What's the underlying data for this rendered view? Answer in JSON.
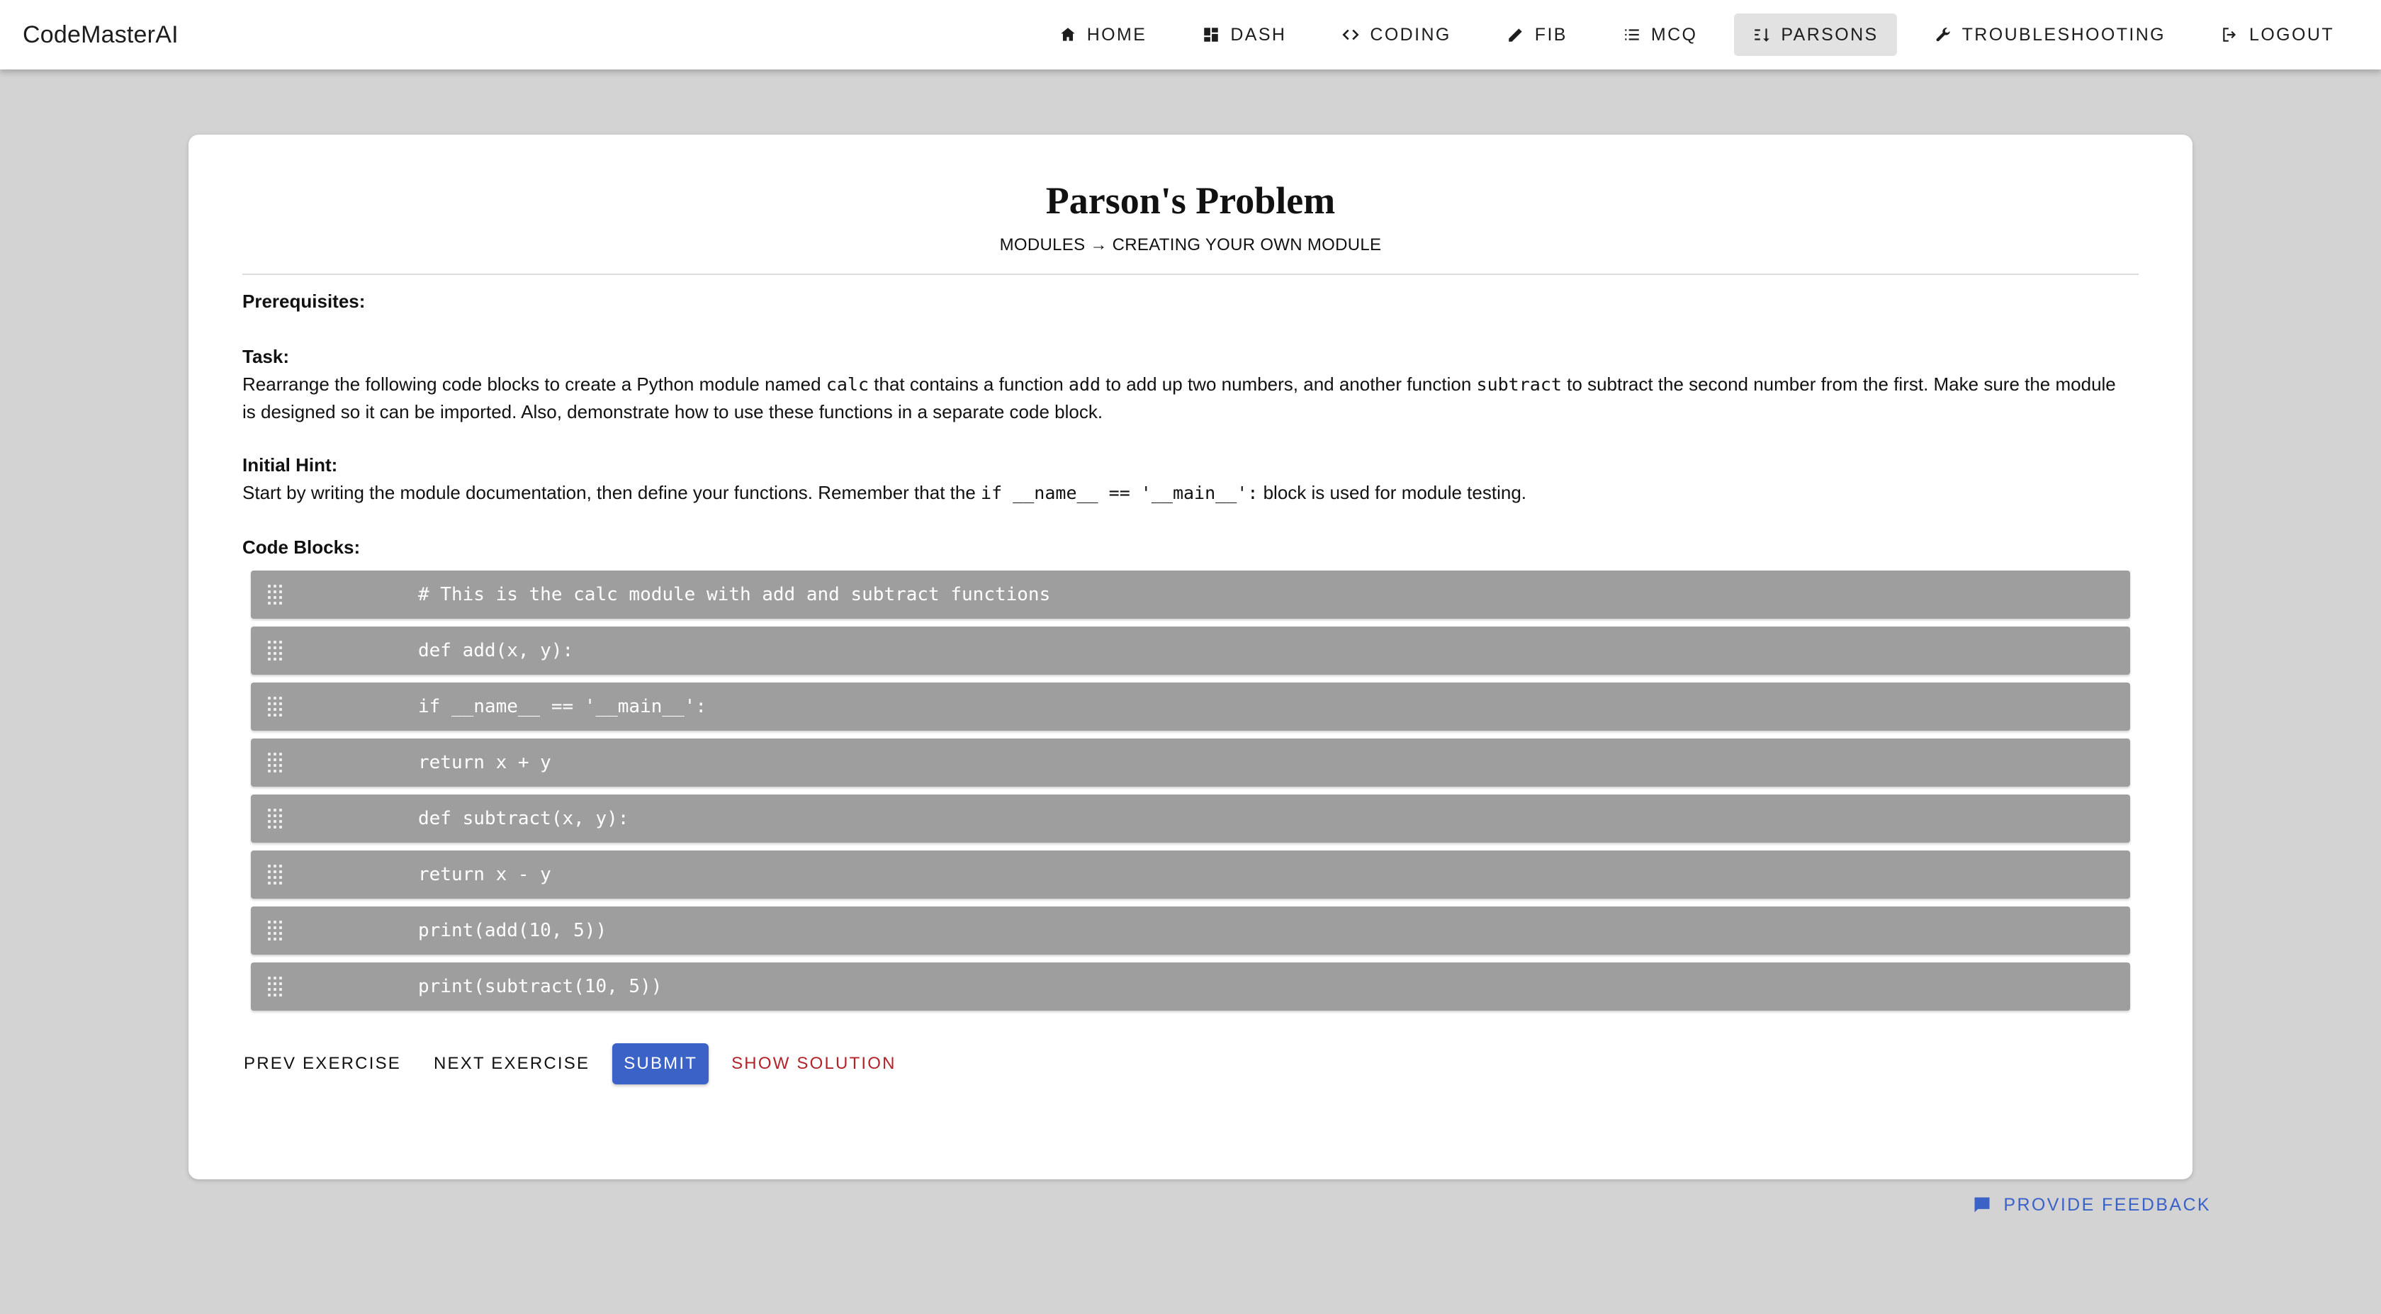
{
  "app": {
    "brand": "CodeMasterAI"
  },
  "nav": {
    "items": [
      {
        "label": "Home",
        "icon": "home-icon"
      },
      {
        "label": "Dash",
        "icon": "dashboard-icon"
      },
      {
        "label": "Coding",
        "icon": "code-icon"
      },
      {
        "label": "FIB",
        "icon": "pencil-icon"
      },
      {
        "label": "MCQ",
        "icon": "list-icon"
      },
      {
        "label": "Parsons",
        "icon": "sort-icon",
        "active": true
      },
      {
        "label": "Troubleshooting",
        "icon": "wrench-icon"
      },
      {
        "label": "Logout",
        "icon": "logout-icon"
      }
    ]
  },
  "page": {
    "title": "Parson's Problem",
    "breadcrumb": "MODULES → CREATING YOUR OWN MODULE",
    "prerequisites_label": "Prerequisites:",
    "task_label": "Task:",
    "task": {
      "t1": "Rearrange the following code blocks to create a Python module named ",
      "c1": "calc",
      "t2": " that contains a function ",
      "c2": "add",
      "t3": " to add up two numbers, and another function ",
      "c3": "subtract",
      "t4": " to subtract the second number from the first. Make sure the module is designed so it can be imported. Also, demonstrate how to use these functions in a separate code block."
    },
    "hint_label": "Initial Hint:",
    "hint": {
      "t1": "Start by writing the module documentation, then define your functions. Remember that the ",
      "c1": "if __name__ == '__main__':",
      "t2": " block is used for module testing."
    },
    "code_blocks_label": "Code Blocks:",
    "code_blocks": [
      "# This is the calc module with add and subtract functions",
      "def add(x, y):",
      "if __name__ == '__main__':",
      "return x + y",
      "def subtract(x, y):",
      "return x - y",
      "print(add(10, 5))",
      "print(subtract(10, 5))"
    ]
  },
  "actions": {
    "prev": "Prev Exercise",
    "next": "Next Exercise",
    "submit": "Submit",
    "solution": "Show Solution"
  },
  "feedback": {
    "label": "Provide Feedback",
    "icon": "comment-icon"
  },
  "colors": {
    "accent": "#3b62c7",
    "danger": "#b3242a",
    "block": "#9e9e9e",
    "background": "#d3d3d3"
  }
}
